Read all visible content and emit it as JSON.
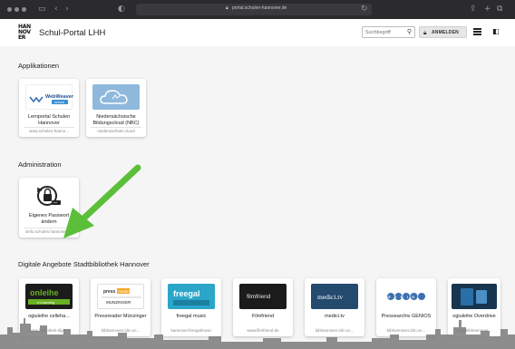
{
  "browser": {
    "url": "portal.schulen-hannover.de"
  },
  "header": {
    "logo_lines": [
      "HAN",
      "NOV",
      "ER"
    ],
    "title": "Schul-Portal LHH",
    "search_placeholder": "Suchbegriff",
    "login_label": "ANMELDEN"
  },
  "sections": {
    "applications": {
      "title": "Applikationen",
      "cards": [
        {
          "name": "Lernportal Schulen Hannover",
          "sub": "www.schulen-hanno...",
          "thumb_text": "WebWeaver school"
        },
        {
          "name": "Niedersächsische Bildungscloud (NBC)",
          "sub": "niedersachsen.cloud",
          "thumb_text": ""
        }
      ]
    },
    "administration": {
      "title": "Administration",
      "cards": [
        {
          "name": "Eigenes Passwort ändern",
          "sub": "sinfo.schulen.hannover.de",
          "thumb_text": ""
        }
      ]
    },
    "library": {
      "title": "Digitale Angebote Stadtbibliothek Hannover",
      "cards": [
        {
          "name": "ogiuleihe celleha...",
          "sub": "www.bibliothek-digit...",
          "thumb_text": "onleihe"
        },
        {
          "name": "Pressreader Münzinger",
          "sub": "bibhannover.idm.oc...",
          "thumb_text": "press reader"
        },
        {
          "name": "freegal music",
          "sub": "hannover.freegalmusic",
          "thumb_text": "freegal"
        },
        {
          "name": "Filmfriend",
          "sub": "www.filmfriend.de",
          "thumb_text": "filmfriend"
        },
        {
          "name": "medici.tv",
          "sub": "bibhannover.idm.oc...",
          "thumb_text": "medici.tv"
        },
        {
          "name": "Pressearchiv GENIOS",
          "sub": "bibhannover.idm.oc...",
          "thumb_text": "GENIOS"
        },
        {
          "name": "ogiuleihe Overdrive",
          "sub": "stadtbibhannover...",
          "thumb_text": ""
        }
      ]
    }
  },
  "colors": {
    "arrow": "#5bbf3a",
    "nbc_blue": "#8fb9dc",
    "onleihe_green": "#6ab023",
    "filmfriend_dark": "#1b1b1b",
    "medici_blue": "#244a6e"
  }
}
